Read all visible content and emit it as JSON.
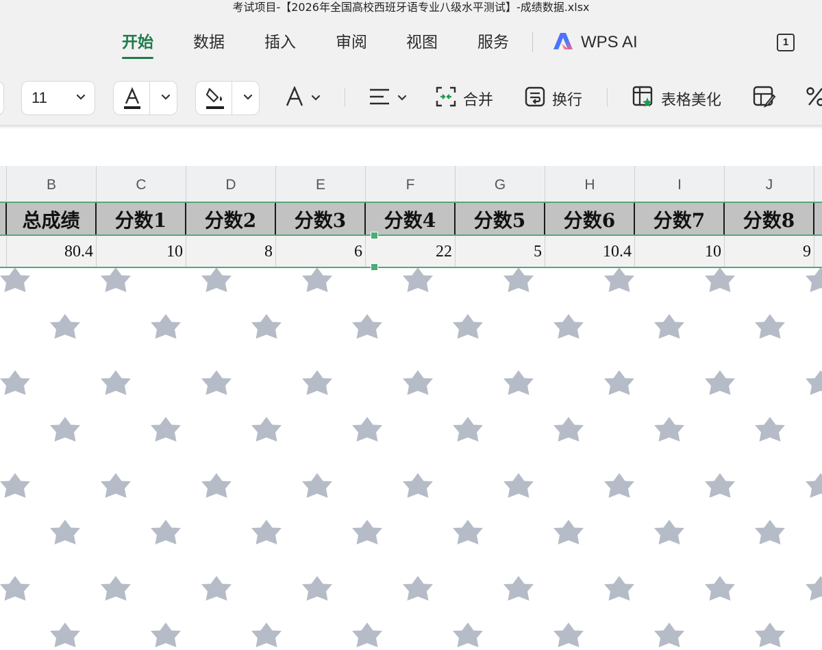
{
  "window": {
    "title": "考试项目-【2026年全国高校西班牙语专业八级水平测试】-成绩数据.xlsx"
  },
  "ribbon": {
    "tabs": [
      {
        "label": "开始",
        "active": true
      },
      {
        "label": "数据"
      },
      {
        "label": "插入"
      },
      {
        "label": "审阅"
      },
      {
        "label": "视图"
      },
      {
        "label": "服务"
      }
    ],
    "ai_label": "WPS AI",
    "window_count": "1"
  },
  "toolbar": {
    "font_size": "11",
    "merge_label": "合并",
    "wrap_label": "换行",
    "beautify_label": "表格美化",
    "font_color": "#1f1f1f",
    "accent": "#1f7a4a"
  },
  "sheet": {
    "columns": [
      "B",
      "C",
      "D",
      "E",
      "F",
      "G",
      "H",
      "I",
      "J"
    ],
    "headers": [
      "总成绩",
      "分数1",
      "分数2",
      "分数3",
      "分数4",
      "分数5",
      "分数6",
      "分数7",
      "分数8"
    ],
    "values": [
      "80.4",
      "10",
      "8",
      "6",
      "22",
      "5",
      "10.4",
      "10",
      "9"
    ],
    "background_pattern": "star-icon",
    "selection_color": "#4faa77"
  }
}
